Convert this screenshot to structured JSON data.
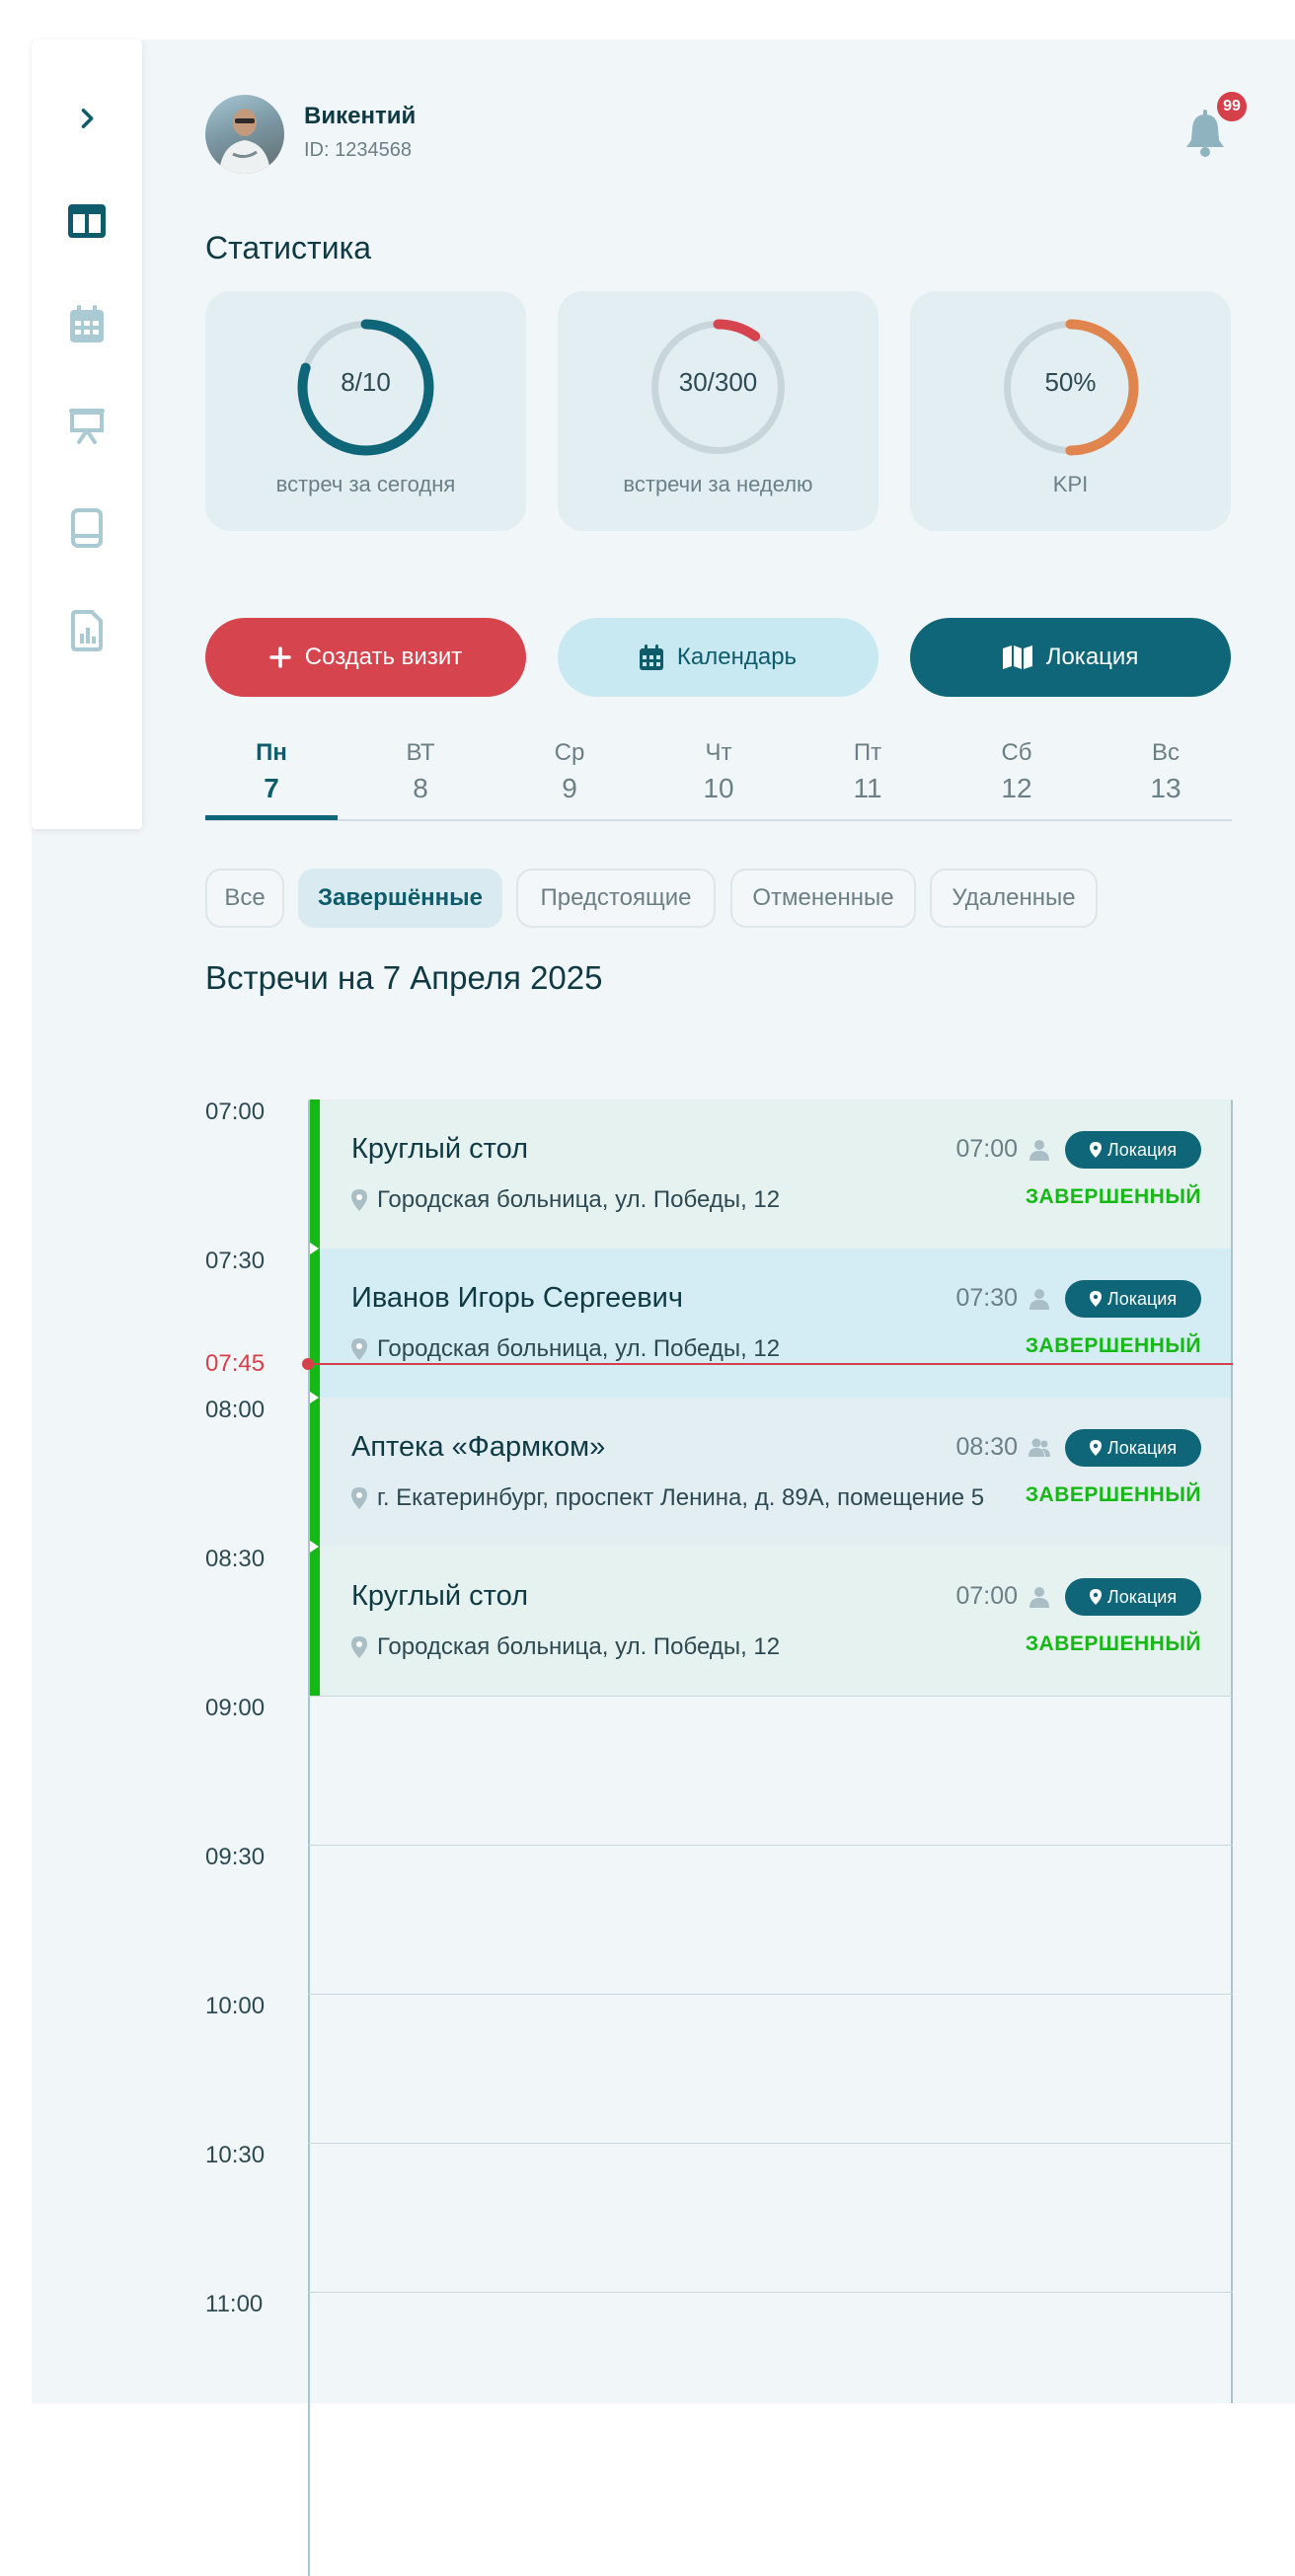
{
  "colors": {
    "primary": "#0e6678",
    "accent_red": "#d6454e",
    "accent_orange": "#e0854e",
    "success": "#16b816",
    "panel_bg": "#f1f6f8"
  },
  "sidebar": {
    "items": [
      {
        "icon": "chevron-right-icon"
      },
      {
        "icon": "dashboard-icon",
        "active": true
      },
      {
        "icon": "calendar-icon"
      },
      {
        "icon": "presentation-icon"
      },
      {
        "icon": "book-icon"
      },
      {
        "icon": "report-chart-icon"
      }
    ]
  },
  "user": {
    "name": "Викентий",
    "id_text": "ID: 1234568"
  },
  "notifications": {
    "count": "99"
  },
  "stats": {
    "title": "Статистика",
    "cards": [
      {
        "value": "8/10",
        "label": "встреч за сегодня",
        "progress": 0.8,
        "color": "#0e6678"
      },
      {
        "value": "30/300",
        "label": "встречи за неделю",
        "progress": 0.1,
        "color": "#d6454e"
      },
      {
        "value": "50%",
        "label": "KPI",
        "progress": 0.5,
        "color": "#e0854e"
      }
    ]
  },
  "actions": {
    "create": "Создать визит",
    "calendar": "Календарь",
    "location": "Локация"
  },
  "week": {
    "days": [
      {
        "name": "Пн",
        "num": "7",
        "active": true
      },
      {
        "name": "ВТ",
        "num": "8"
      },
      {
        "name": "Ср",
        "num": "9"
      },
      {
        "name": "Чт",
        "num": "10"
      },
      {
        "name": "Пт",
        "num": "11"
      },
      {
        "name": "Сб",
        "num": "12"
      },
      {
        "name": "Вс",
        "num": "13"
      }
    ]
  },
  "filters": [
    "Все",
    "Завершённые",
    "Предстоящие",
    "Отмененные",
    "Удаленные"
  ],
  "active_filter": "Завершённые",
  "meetings_title": "Встречи на 7 Апреля 2025",
  "timeline": {
    "times": [
      "07:00",
      "07:30",
      "08:00",
      "08:30",
      "09:00",
      "09:30",
      "10:00",
      "10:30",
      "11:00"
    ],
    "now": "07:45"
  },
  "events": [
    {
      "title": "Круглый стол",
      "address": "Городская больница, ул. Победы, 12",
      "time": "07:00",
      "people_icon": "person-icon",
      "location_label": "Локация",
      "status": "ЗАВЕРШЕННЫЙ"
    },
    {
      "title": "Иванов Игорь Сергеевич",
      "address": "Городская больница, ул. Победы, 12",
      "time": "07:30",
      "people_icon": "person-icon",
      "location_label": "Локация",
      "status": "ЗАВЕРШЕННЫЙ"
    },
    {
      "title": "Аптека «Фармком»",
      "address": "г. Екатеринбург, проспект Ленина, д. 89А, помещение 5",
      "time": "08:30",
      "people_icon": "group-icon",
      "location_label": "Локация",
      "status": "ЗАВЕРШЕННЫЙ"
    },
    {
      "title": "Круглый стол",
      "address": "Городская больница, ул. Победы, 12",
      "time": "07:00",
      "people_icon": "person-icon",
      "location_label": "Локация",
      "status": "ЗАВЕРШЕННЫЙ"
    }
  ]
}
